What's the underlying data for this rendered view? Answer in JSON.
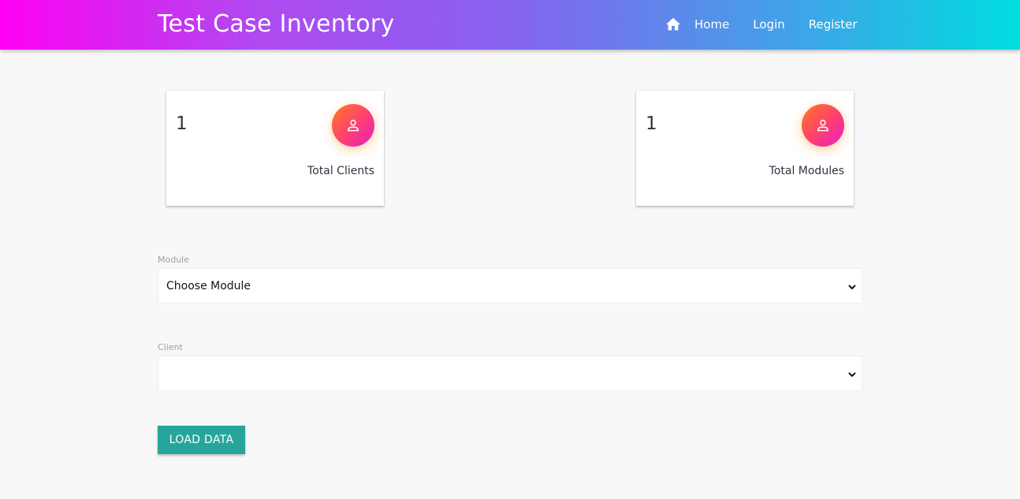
{
  "navbar": {
    "brand": "Test Case Inventory",
    "links": [
      {
        "label": "Home",
        "icon": "home-icon"
      },
      {
        "label": "Login"
      },
      {
        "label": "Register"
      }
    ],
    "gradient": [
      "#ff00f2",
      "#8663ee",
      "#00dde0"
    ]
  },
  "cards": [
    {
      "count": "1",
      "label": "Total Clients",
      "icon": "person-icon"
    },
    {
      "count": "1",
      "label": "Total Modules",
      "icon": "person-icon"
    }
  ],
  "form": {
    "module": {
      "label": "Module",
      "selected": "Choose Module"
    },
    "client": {
      "label": "Client",
      "selected": ""
    },
    "submit_label": "LOAD DATA"
  },
  "colors": {
    "button": "#26a69a",
    "icon_gradient": [
      "#ff7a1e",
      "#ff3d74",
      "#e91ec9"
    ]
  }
}
